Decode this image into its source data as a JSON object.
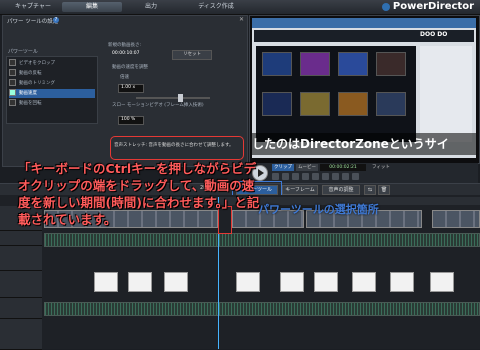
{
  "top_bar": {
    "tabs": [
      "キャプチャー",
      "編集",
      "出力",
      "ディスク作成"
    ],
    "brand": "PowerDirector"
  },
  "panel": {
    "title": "パワー ツールの設定",
    "help": "?",
    "tool_list_header": "パワーツール",
    "tools": [
      "ビデオをクロップ",
      "動画の反転",
      "動画のトリミング",
      "動画速度",
      "動画を回転"
    ],
    "selected_tool_index": 3,
    "new_duration_label": "新規の動画長さ:",
    "new_duration_value": "00:00:10:07",
    "reset_label": "リセット",
    "stretch_option": "動画の速度を調整",
    "speed_label": "倍速",
    "speed_value": "1.00 x",
    "slow_motion_option": "スロー モーションビデオ (フレーム挿入技術)",
    "percent_value": "100 %",
    "note_text": "音声ストレッチ: 音声を動画の長さに合わせて調整します。"
  },
  "preview": {
    "header_logo": "DOO DO",
    "caption": "したのはDirectorZoneというサイ",
    "clip_tab": "クリップ",
    "movie_tab": "ムービー",
    "timecode": "00:00:02:21",
    "fit_label": "フィット"
  },
  "toolbar": {
    "left_label": "2D/3D",
    "power_tool": "パワーツール",
    "keyframe": "キーフレーム",
    "audio": "音声の調整"
  },
  "annotations": {
    "red_note": "「キーボードのCtrlキーを押しながらビデオクリップの端をドラッグして、動画の速度を新しい期間(時間)に合わせます。」と記載されています。",
    "blue_note": "パワーツールの選択箇所"
  }
}
